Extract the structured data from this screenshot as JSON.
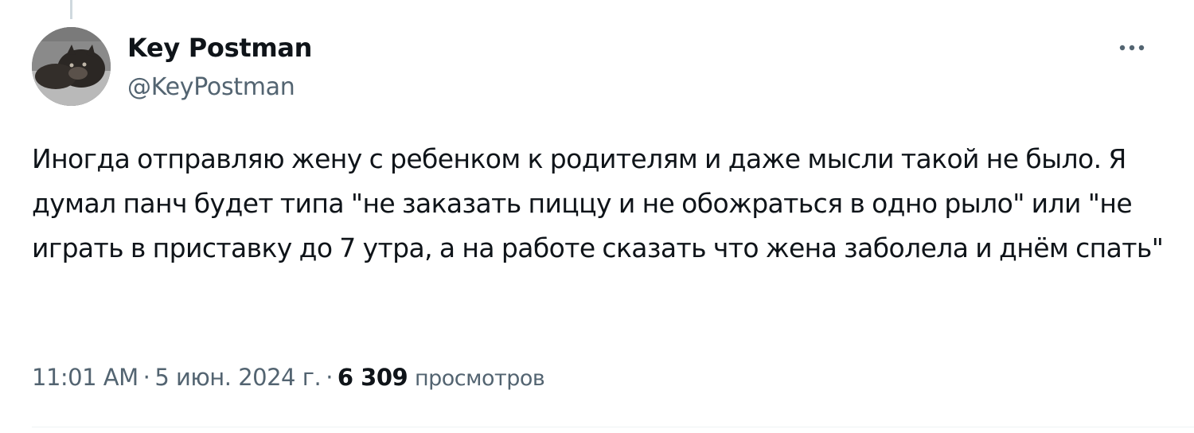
{
  "author": {
    "display_name": "Key Postman",
    "handle": "@KeyPostman",
    "avatar_icon": "cat-avatar-icon"
  },
  "tweet": {
    "text": "Иногда отправляю жену с ребенком к родителям и даже мысли такой не было. Я думал панч будет типа \"не заказать пиццу и не обожраться в одно рыло\" или \"не играть в приставку до 7 утра, а на работе сказать что жена заболела и днём спать\""
  },
  "meta": {
    "time": "11:01 AM",
    "date": "5 июн. 2024 г.",
    "separator": "·",
    "views_count": "6 309",
    "views_label": "просмотров"
  },
  "actions": {
    "more_icon": "more-horizontal-icon"
  },
  "colors": {
    "primary_text": "#0f1419",
    "secondary_text": "#536471",
    "divider": "#eff3f4",
    "thread_line": "#cfd9de"
  }
}
